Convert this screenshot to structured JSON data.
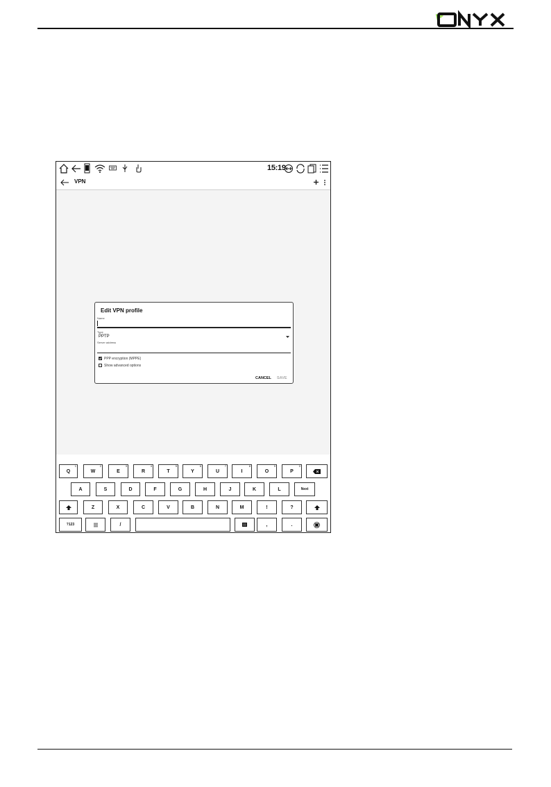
{
  "brand": {
    "logo_text": "ONYX",
    "accent": "#7fd63a"
  },
  "status_bar": {
    "time": "15:19",
    "icons": [
      "home-icon",
      "back-icon",
      "phone-icon",
      "wifi-icon",
      "keyboard-icon",
      "usb-icon",
      "touch-icon",
      "refresh-mode-icon",
      "sync-icon",
      "screenshot-icon",
      "menu-icon"
    ]
  },
  "app_bar": {
    "title": "VPN"
  },
  "dialog": {
    "title": "Edit VPN profile",
    "name_label": "Name",
    "name_value": "",
    "type_label": "Type",
    "type_value": "PPTP",
    "server_label": "Server address",
    "server_value": "",
    "ppp_encryption_label": "PPP encryption (MPPE)",
    "ppp_encryption_checked": true,
    "advanced_label": "Show advanced options",
    "advanced_checked": false,
    "cancel_label": "CANCEL",
    "save_label": "SAVE"
  },
  "keyboard": {
    "row1": [
      {
        "k": "Q",
        "h": "1"
      },
      {
        "k": "W",
        "h": "2"
      },
      {
        "k": "E",
        "h": "3"
      },
      {
        "k": "R",
        "h": "4"
      },
      {
        "k": "T",
        "h": "5"
      },
      {
        "k": "Y",
        "h": "6"
      },
      {
        "k": "U",
        "h": "7"
      },
      {
        "k": "I",
        "h": "8"
      },
      {
        "k": "O",
        "h": "9"
      },
      {
        "k": "P",
        "h": "0"
      }
    ],
    "row2": [
      "A",
      "S",
      "D",
      "F",
      "G",
      "H",
      "J",
      "K",
      "L"
    ],
    "next_label": "Next",
    "row3": [
      "Z",
      "X",
      "C",
      "V",
      "B",
      "N",
      "M",
      "!",
      "?"
    ],
    "symbols_label": "?123",
    "comma_key": ",",
    "slash_key": "/",
    "period_key": ".",
    "dot_key": "."
  }
}
